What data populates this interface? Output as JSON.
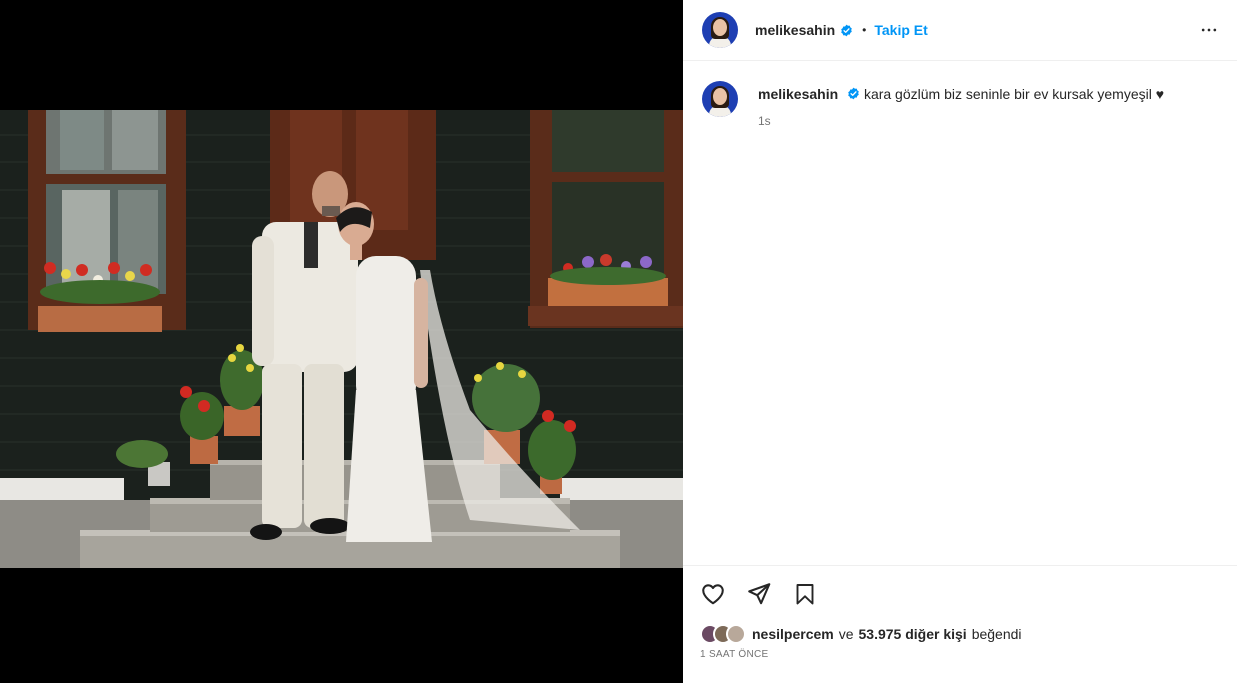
{
  "post": {
    "author": "melikesahin",
    "follow_label": "Takip Et",
    "separator": "•"
  },
  "caption": {
    "username": "melikesahin",
    "text": "kara gözlüm biz seninle bir ev kursak yemyeşil ♥",
    "age": "1s"
  },
  "likes": {
    "first_liker": "nesilpercem",
    "connector": "ve",
    "others": "53.975 diğer kişi",
    "suffix": "beğendi"
  },
  "timestamp": "1 SAAT ÖNCE",
  "icons": {
    "like": "heart-icon",
    "share": "send-icon",
    "save": "bookmark-icon",
    "more": "more-horizontal-icon",
    "verified": "verified-badge-icon"
  },
  "colors": {
    "follow": "#0095f6",
    "verified": "#0095f6",
    "secondary_text": "#737373"
  }
}
